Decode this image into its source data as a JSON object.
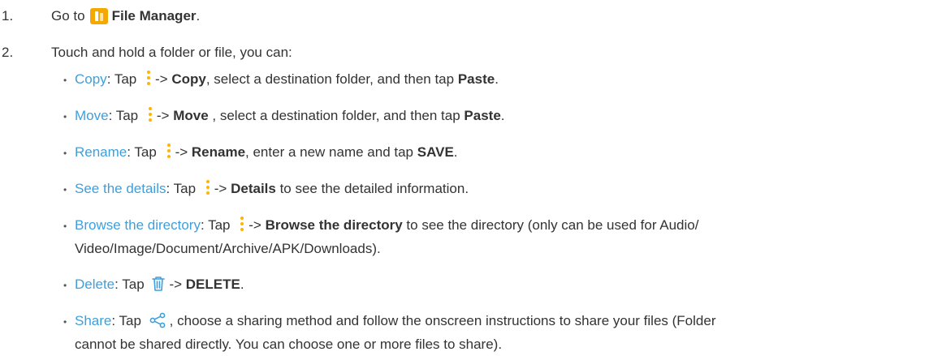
{
  "step1": {
    "num": "1.",
    "prefix": "Go to",
    "app_name": "File Manager",
    "suffix": "."
  },
  "step2": {
    "num": "2.",
    "text": "Touch and hold a folder or file, you can:"
  },
  "items": [
    {
      "link": "Copy",
      "pre": ": Tap",
      "arrow": "->",
      "bold": "Copy",
      "mid": ", select a destination folder, and then tap",
      "bold2": "Paste",
      "end": "."
    },
    {
      "link": "Move",
      "pre": ": Tap",
      "arrow": "->",
      "bold": "Move",
      "mid": " , select a destination folder, and then tap",
      "bold2": "Paste",
      "end": "."
    },
    {
      "link": "Rename",
      "pre": ": Tap",
      "arrow": "->",
      "bold": "Rename",
      "mid": ", enter a new name and tap",
      "bold2": "SAVE",
      "end": "."
    },
    {
      "link": "See the details",
      "pre": ": Tap",
      "arrow": "->",
      "bold": "Details",
      "mid": "to see the detailed information."
    },
    {
      "link": "Browse the directory",
      "pre": ": Tap",
      "arrow": "->",
      "bold": "Browse the directory",
      "mid": "to see the directory (only can be used for Audio/",
      "cont": "Video/Image/Document/Archive/APK/Downloads)."
    },
    {
      "link": "Delete",
      "pre": ": Tap",
      "arrow": "->",
      "bold": "DELETE",
      "end": "."
    },
    {
      "link": "Share",
      "pre": ": Tap",
      "mid": ", choose a sharing method and follow the onscreen instructions to share your files (Folder",
      "cont": "cannot be shared directly. You can choose one or more files to share)."
    }
  ],
  "colors": {
    "link": "#3e9fdc",
    "icon_accent": "#ffb400",
    "app_icon": "#f5a800",
    "text": "#333333"
  },
  "icons": {
    "app": "file-manager-icon",
    "more": "more-vertical-icon",
    "delete": "trash-icon",
    "share": "share-icon"
  }
}
